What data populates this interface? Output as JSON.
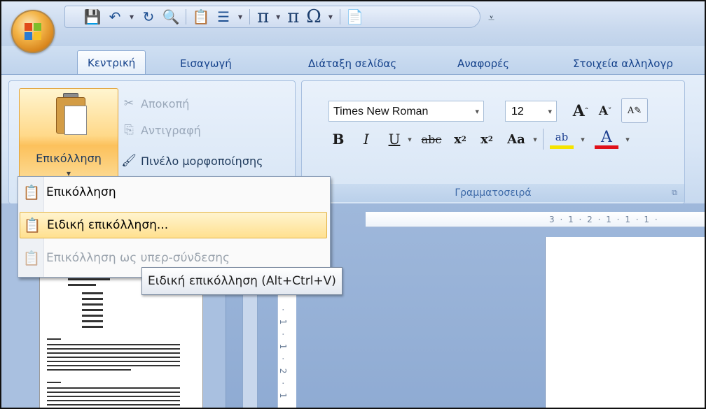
{
  "tabs": [
    "Κεντρική",
    "Εισαγωγή",
    "Διάταξη σελίδας",
    "Αναφορές",
    "Στοιχεία αλληλογρ"
  ],
  "clipboard": {
    "paste": "Επικόλληση",
    "cut": "Αποκοπή",
    "copy": "Αντιγραφή",
    "format_painter": "Πινέλο μορφοποίησης"
  },
  "font": {
    "name": "Times New Roman",
    "size": "12",
    "group_caption": "Γραμματοσειρά"
  },
  "paste_menu": {
    "items": [
      {
        "label": "Επικόλληση",
        "state": "normal"
      },
      {
        "label": "Ειδική επικόλληση...",
        "state": "highlighted"
      },
      {
        "label": "Επικόλληση ως υπερ-σύνδεσης",
        "state": "disabled"
      }
    ]
  },
  "tooltip": "Ειδική επικόλληση (Alt+Ctrl+V)",
  "ruler_text": "3 · 1 · 2 · 1 · 1 · 1 ·",
  "vruler_text": "· 1 · 1 · 2 · 1"
}
